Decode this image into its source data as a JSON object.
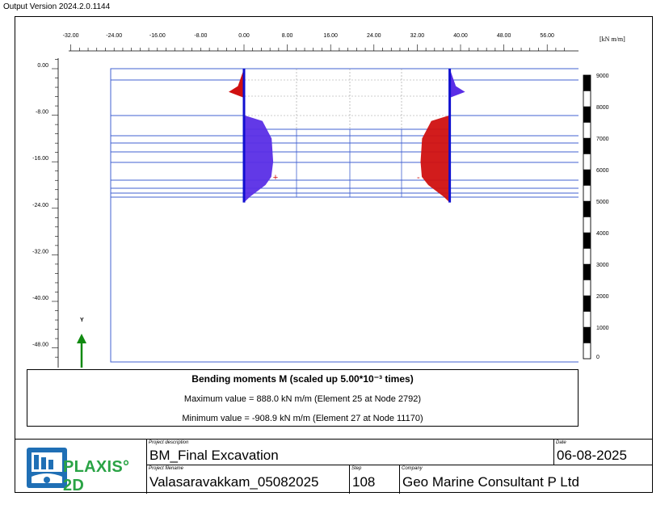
{
  "version_text": "Output Version 2024.2.0.1144",
  "chart_data": {
    "type": "line",
    "title": "Bending moments M (scaled up 5.00*10⁻³ times)",
    "x_ticks": [
      "-32.00",
      "-24.00",
      "-16.00",
      "-8.00",
      "0.00",
      "8.00",
      "16.00",
      "24.00",
      "32.00",
      "40.00",
      "48.00",
      "56.00"
    ],
    "x_unit": "[kN m/m]",
    "y_ticks": [
      "0.00",
      "-8.00",
      "-16.00",
      "-24.00",
      "-32.00",
      "-40.00",
      "-48.00"
    ],
    "axis_label": "Y",
    "scale_ticks": [
      "9000",
      "8000",
      "7000",
      "6000",
      "5000",
      "4000",
      "3000",
      "2000",
      "1000",
      "0"
    ],
    "series": [
      {
        "name": "Left wall",
        "wall_x": 0.0,
        "depth": [
          0,
          -3,
          -4,
          -5,
          -8,
          -9,
          -12,
          -16,
          -18.6,
          -20,
          -22,
          -23
        ],
        "moment": [
          0,
          -200,
          -500,
          0,
          0,
          600,
          900,
          950,
          888,
          700,
          200,
          0
        ]
      },
      {
        "name": "Right wall",
        "wall_x": 38.0,
        "depth": [
          0,
          -3,
          -4,
          -5,
          -8,
          -9,
          -12,
          -16,
          -18.6,
          -20,
          -22,
          -23
        ],
        "moment": [
          0,
          200,
          500,
          0,
          0,
          -600,
          -900,
          -950,
          -908.9,
          -700,
          -200,
          0
        ]
      }
    ],
    "max_marker": "+",
    "min_marker": "-"
  },
  "caption": {
    "title": "Bending moments M (scaled up 5.00*10⁻³ times)",
    "max_text": "Maximum value = 888.0 kN m/m (Element 25 at Node 2792)",
    "min_text": "Minimum value = -908.9 kN m/m (Element 27 at Node 11170)"
  },
  "title_block": {
    "logo_text": "PLAXIS° 2D",
    "project_description_label": "Project description",
    "project_description": "BM_Final Excavation",
    "date_label": "Date",
    "date": "06-08-2025",
    "project_filename_label": "Project filename",
    "project_filename": "Valasaravakkam_05082025",
    "step_label": "Step",
    "step": "108",
    "company_label": "Company",
    "company": "Geo Marine Consultant P Ltd"
  },
  "colors": {
    "wall": "#1010d0",
    "positive": "#5a2ee6",
    "negative": "#d01010",
    "axis_arrow": "#108a10",
    "layer_line": "#4060d0"
  }
}
